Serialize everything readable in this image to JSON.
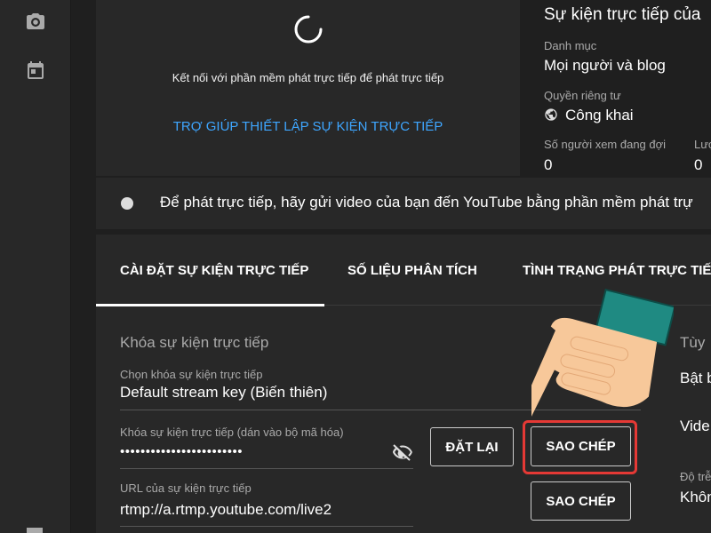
{
  "sidebar": {
    "items": [
      {
        "icon": "camera-icon"
      },
      {
        "icon": "calendar-icon"
      }
    ]
  },
  "preview": {
    "status_text": "Kết nối với phần mềm phát trực tiếp để phát trực tiếp",
    "help_link": "TRỢ GIÚP THIẾT LẬP SỰ KIỆN TRỰC TIẾP"
  },
  "info": {
    "title": "Sự kiện trực tiếp của",
    "category_label": "Danh mục",
    "category_value": "Mọi người và blog",
    "privacy_label": "Quyền riêng tư",
    "privacy_value": "Công khai",
    "waiting_label": "Số người xem đang đợi",
    "waiting_value": "0",
    "likes_label": "Lượ",
    "likes_value": "0"
  },
  "banner": {
    "text": "Để phát trực tiếp, hãy gửi video của bạn đến YouTube bằng phần mềm phát trự"
  },
  "tabs": [
    {
      "label": "CÀI ĐẶT SỰ KIỆN TRỰC TIẾP",
      "active": true
    },
    {
      "label": "SỐ LIỆU PHÂN TÍCH",
      "active": false
    },
    {
      "label": "TÌNH TRẠNG PHÁT TRỰC TIẾP",
      "active": false
    }
  ],
  "stream_key": {
    "section_title": "Khóa sự kiện trực tiếp",
    "select_label": "Chọn khóa sự kiện trực tiếp",
    "select_value": "Default stream key (Biến thiên)",
    "key_label": "Khóa sự kiện trực tiếp (dán vào bộ mã hóa)",
    "key_value": "••••••••••••••••••••••••",
    "reset_button": "ĐẶT LẠI",
    "copy_key_button": "SAO CHÉP",
    "url_label": "URL của sự kiện trực tiếp",
    "url_value": "rtmp://a.rtmp.youtube.com/live2",
    "copy_url_button": "SAO CHÉP"
  },
  "right_column": {
    "heading": "Tùy",
    "item1": "Bật b",
    "item2": "Vide",
    "small_label": "Độ trễ",
    "value": "Khôn"
  },
  "colors": {
    "accent_link": "#3ea6ff",
    "highlight": "#e53935",
    "cuff": "#1f8a82",
    "hand": "#f7c89a"
  }
}
